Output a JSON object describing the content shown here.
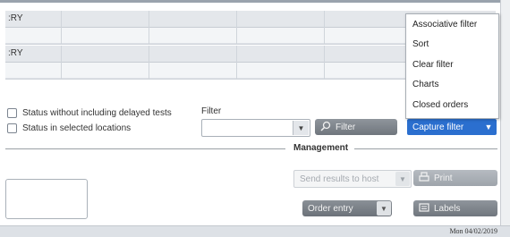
{
  "grid_top": {
    "header_fragment": ":RY"
  },
  "grid_bottom": {
    "header_fragment": ":RY"
  },
  "status_filters": [
    {
      "label": "Status without including delayed tests"
    },
    {
      "label": "Status in selected locations"
    }
  ],
  "filter": {
    "label": "Filter",
    "button_label": "Filter"
  },
  "capture_filter": {
    "label": "Capture filter"
  },
  "menu": {
    "items": [
      "Associative filter",
      "Sort",
      "Clear filter",
      "Charts",
      "Closed orders"
    ]
  },
  "management": {
    "title": "Management",
    "send_results_label": "Send results to host",
    "print_label": "Print",
    "order_entry_label": "Order entry",
    "labels_label": "Labels"
  },
  "status_bar": {
    "date": "Mon 04/02/2019"
  },
  "colors": {
    "accent": "#2b6fcf",
    "button_gray": "#7d838a"
  }
}
